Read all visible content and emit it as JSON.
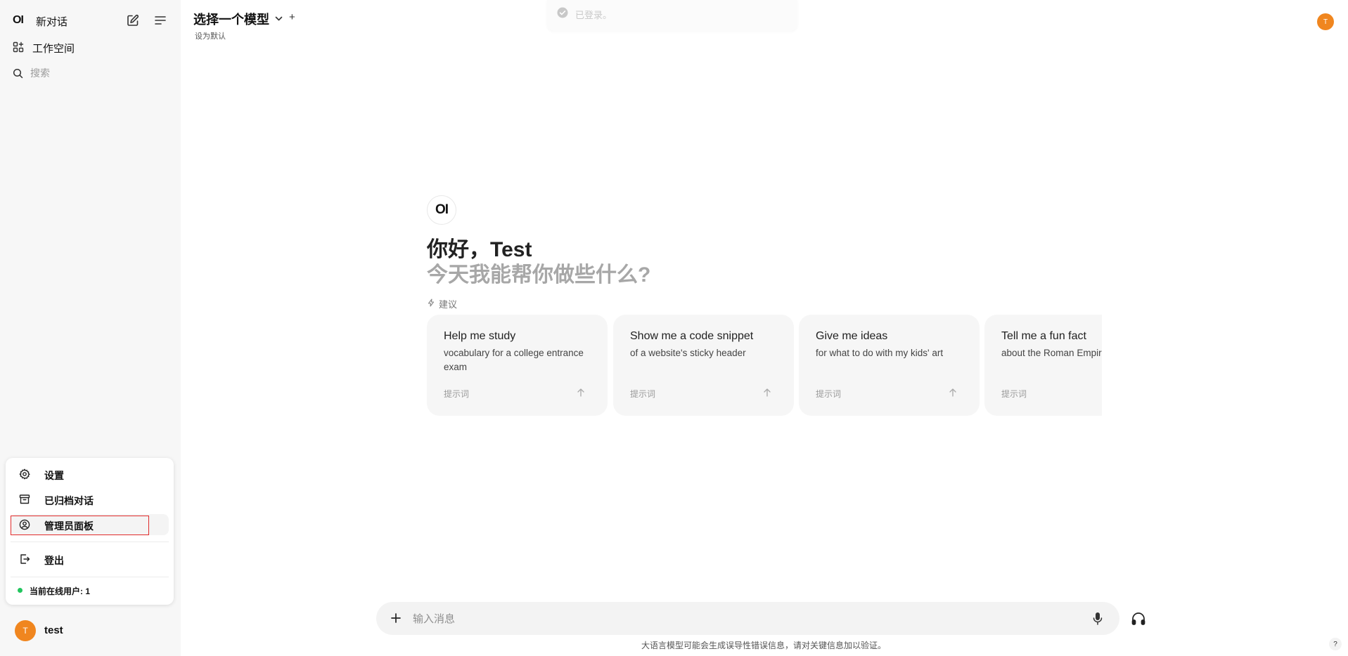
{
  "sidebar": {
    "logo": "OI",
    "new_chat": "新对话",
    "workspace": "工作空间",
    "search_placeholder": "搜索",
    "user_menu": {
      "settings": "设置",
      "archived": "已归档对话",
      "admin_panel": "管理员面板",
      "logout": "登出",
      "online_users": "当前在线用户: 1"
    },
    "user": {
      "avatar_letter": "T",
      "name": "test"
    }
  },
  "header": {
    "model_select": "选择一个模型",
    "add": "+",
    "set_default": "设为默认",
    "avatar_letter": "T"
  },
  "toast": {
    "text": "已登录。"
  },
  "main": {
    "logo": "OI",
    "greeting": "你好，Test",
    "subgreeting": "今天我能帮你做些什么?",
    "suggestions_label": "建议",
    "cards": [
      {
        "title": "Help me study",
        "subtitle": "vocabulary for a college entrance exam",
        "tag": "提示词"
      },
      {
        "title": "Show me a code snippet",
        "subtitle": "of a website's sticky header",
        "tag": "提示词"
      },
      {
        "title": "Give me ideas",
        "subtitle": "for what to do with my kids' art",
        "tag": "提示词"
      },
      {
        "title": "Tell me a fun fact",
        "subtitle": "about the Roman Empire",
        "tag": "提示词"
      }
    ]
  },
  "composer": {
    "placeholder": "输入消息",
    "disclaimer": "大语言模型可能会生成误导性错误信息，请对关键信息加以验证。",
    "help": "?"
  },
  "colors": {
    "accent_avatar": "#f0861f",
    "online_dot": "#22c55e",
    "highlight_box": "#e02b2b"
  }
}
